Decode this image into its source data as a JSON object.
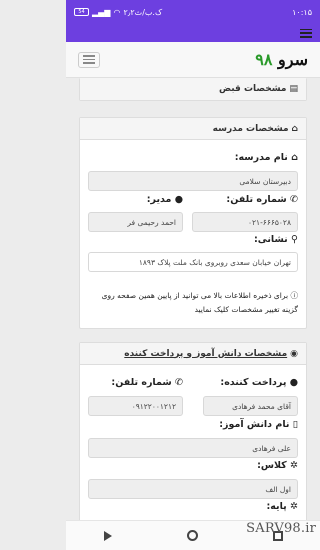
{
  "status_bar": {
    "time": "۱۰:۱۵",
    "speed": "۲٫۲ک.ب/ث",
    "battery": "54"
  },
  "navbar": {
    "brand_text": "سرو",
    "brand_num": "۹۸"
  },
  "receipt_section": {
    "title": "مشخصات قبض"
  },
  "school_section": {
    "title": "مشخصات مدرسه",
    "school_name_label": "نام مدرسه:",
    "school_name_value": "دبیرستان سلامی",
    "phone_label": "شماره تلفن:",
    "phone_value": "۰۲۱-۶۶۶۵۰۲۸",
    "principal_label": "مدیر:",
    "principal_value": "احمد رحیمی فر",
    "address_label": "نشانی:",
    "address_value": "تهران خیابان سعدی روبروی بانک ملت پلاک ۱۸۹۳",
    "info_note": "برای ذخیره اطلاعات بالا می توانید از پایین همین صفحه روی گزینه تغییر مشخصات کلیک نمایید"
  },
  "student_section": {
    "title": "مشخصات دانش آموز و پرداخت کننده",
    "payer_label": "پرداخت کننده:",
    "payer_value": "آقای محمد فرهادی",
    "phone_label": "شماره تلفن:",
    "phone_value": "۰۹۱۲۲۰۰۱۲۱۲",
    "student_name_label": "نام دانش آموز:",
    "student_name_value": "علی فرهادی",
    "class_label": "کلاس:",
    "class_value": "اول الف",
    "next_label": "پایه:"
  },
  "watermark": "SARV98.ir"
}
